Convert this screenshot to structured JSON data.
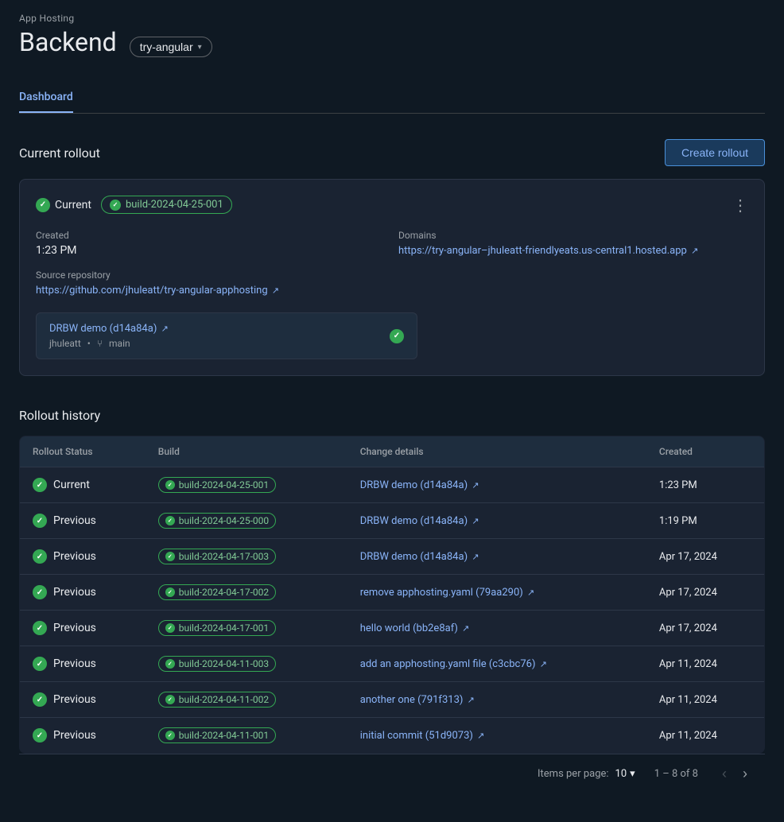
{
  "app": {
    "hosting_label": "App Hosting",
    "backend_title": "Backend"
  },
  "branch_selector": {
    "label": "try-angular"
  },
  "tabs": [
    {
      "label": "Dashboard",
      "active": true
    }
  ],
  "current_rollout": {
    "section_title": "Current rollout",
    "create_button_label": "Create rollout",
    "status": "Current",
    "build_id": "build-2024-04-25-001",
    "created_label": "Created",
    "created_value": "1:23 PM",
    "source_repo_label": "Source repository",
    "source_repo_url": "https://github.com/jhuleatt/try-angular-apphosting",
    "source_repo_display": "https://github.com/jhuleatt/try-angular-apphosting ",
    "domains_label": "Domains",
    "domain_url": "https://try-angular–jhuleatt-friendlyeats.us-central1.hosted.app",
    "domain_display": "https://try-angular–jhuleatt-friendlyeats.us-central1.hosted.app",
    "commit_link": "DRBW demo (d14a84a)",
    "commit_author": "jhuleatt",
    "commit_branch": "main"
  },
  "rollout_history": {
    "title": "Rollout history",
    "columns": [
      "Rollout Status",
      "Build",
      "Change details",
      "Created"
    ],
    "rows": [
      {
        "status": "Current",
        "build": "build-2024-04-25-001",
        "change": "DRBW demo (d14a84a)",
        "created": "1:23 PM"
      },
      {
        "status": "Previous",
        "build": "build-2024-04-25-000",
        "change": "DRBW demo (d14a84a)",
        "created": "1:19 PM"
      },
      {
        "status": "Previous",
        "build": "build-2024-04-17-003",
        "change": "DRBW demo (d14a84a)",
        "created": "Apr 17, 2024"
      },
      {
        "status": "Previous",
        "build": "build-2024-04-17-002",
        "change": "remove apphosting.yaml (79aa290)",
        "created": "Apr 17, 2024"
      },
      {
        "status": "Previous",
        "build": "build-2024-04-17-001",
        "change": "hello world (bb2e8af)",
        "created": "Apr 17, 2024"
      },
      {
        "status": "Previous",
        "build": "build-2024-04-11-003",
        "change": "add an apphosting.yaml file (c3cbc76)",
        "created": "Apr 11, 2024"
      },
      {
        "status": "Previous",
        "build": "build-2024-04-11-002",
        "change": "another one (791f313)",
        "created": "Apr 11, 2024"
      },
      {
        "status": "Previous",
        "build": "build-2024-04-11-001",
        "change": "initial commit (51d9073)",
        "created": "Apr 11, 2024"
      }
    ]
  },
  "pagination": {
    "items_per_page_label": "Items per page:",
    "items_per_page_value": "10",
    "page_range": "1 – 8 of 8"
  }
}
